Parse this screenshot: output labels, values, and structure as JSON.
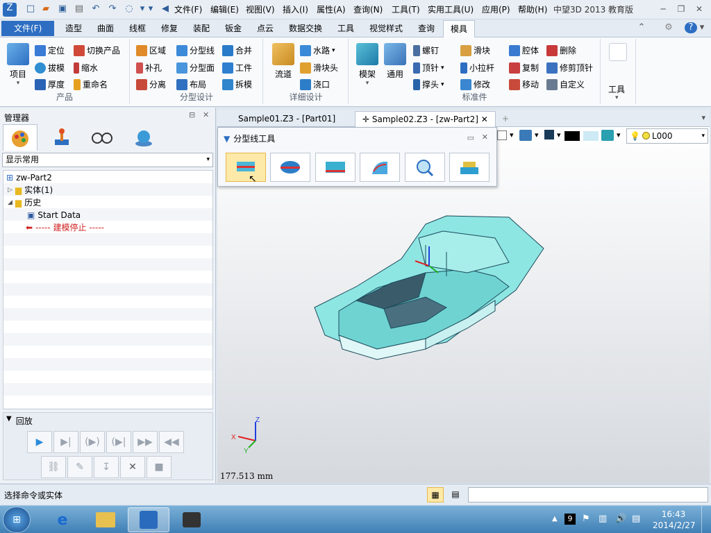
{
  "window": {
    "title": "中望3D 2013 教育版"
  },
  "menu": [
    "文件(F)",
    "编辑(E)",
    "视图(V)",
    "插入(I)",
    "属性(A)",
    "查询(N)",
    "工具(T)",
    "实用工具(U)",
    "应用(P)",
    "帮助(H)"
  ],
  "ribbon_tabs": [
    "文件(F)",
    "造型",
    "曲面",
    "线框",
    "修复",
    "装配",
    "钣金",
    "点云",
    "数据交换",
    "工具",
    "视觉样式",
    "查询",
    "模具"
  ],
  "ribbon_groups": {
    "product": {
      "label": "产品",
      "big": "项目",
      "items": [
        "定位",
        "切换产品",
        "拔模",
        "缩水",
        "厚度",
        "重命名"
      ]
    },
    "parting": {
      "label": "分型设计",
      "items": [
        "区域",
        "分型线",
        "合并",
        "补孔",
        "分型面",
        "工件",
        "分离",
        "布局",
        "拆模"
      ]
    },
    "detail": {
      "label": "详细设计",
      "big": "流道",
      "items": [
        "水路",
        "滑块头",
        "浇口"
      ]
    },
    "standard": {
      "label": "标准件",
      "big1": "模架",
      "big2": "通用",
      "items": [
        "螺钉",
        "滑块",
        "腔体",
        "删除",
        "顶针",
        "小拉杆",
        "复制",
        "修剪顶针",
        "撑头",
        "修改",
        "移动",
        "自定义"
      ]
    },
    "tools": {
      "label": "工具"
    }
  },
  "manager": {
    "title": "管理器",
    "dropdown": "显示常用",
    "tree": [
      "zw-Part2",
      "实体(1)",
      "历史",
      "Start Data",
      "----- 建模停止 -----"
    ],
    "playback_title": "回放"
  },
  "doc_tabs": [
    "Sample01.Z3 - [Part01]",
    "Sample02.Z3 - [zw-Part2]"
  ],
  "parting_toolbar": {
    "title": "分型线工具"
  },
  "view_toolbar": {
    "layer": "L000"
  },
  "viewport": {
    "distance": "177.513 mm",
    "axis_x": "X",
    "axis_y": "Y",
    "axis_z": "Z"
  },
  "status": {
    "text": "选择命令或实体"
  },
  "taskbar": {
    "time": "16:43",
    "date": "2014/2/27",
    "badge": "9"
  },
  "colors": {
    "accent": "#2d6ec2",
    "model": "#7fe0df",
    "highlight": "#fde9a8"
  }
}
